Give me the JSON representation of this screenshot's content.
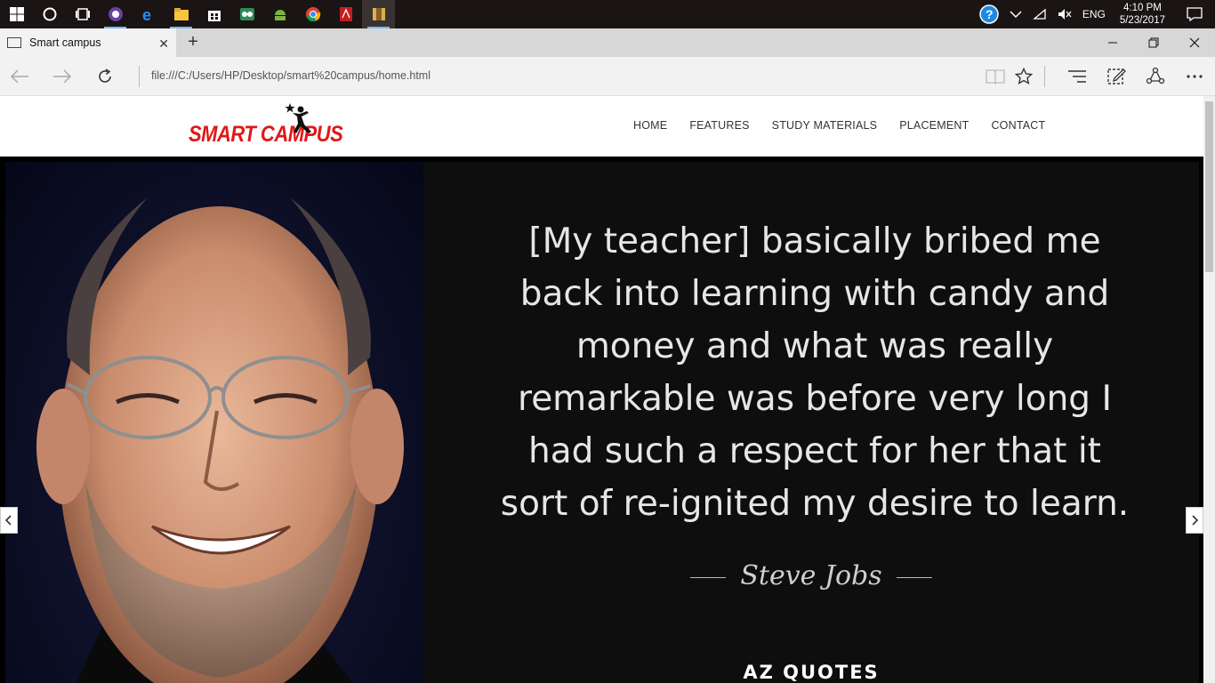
{
  "taskbar": {
    "apps": [
      {
        "icon": "windows-start-icon"
      },
      {
        "icon": "search-cortana-icon"
      },
      {
        "icon": "task-view-icon"
      },
      {
        "icon": "purple-app-icon"
      },
      {
        "icon": "edge-icon"
      },
      {
        "icon": "file-explorer-icon"
      },
      {
        "icon": "store-icon"
      },
      {
        "icon": "tripadvisor-icon"
      },
      {
        "icon": "android-icon"
      },
      {
        "icon": "chrome-icon"
      },
      {
        "icon": "acrobat-icon"
      },
      {
        "icon": "winrar-icon"
      }
    ],
    "tray": {
      "language": "ENG",
      "time": "4:10 PM",
      "date": "5/23/2017"
    }
  },
  "browser": {
    "tab_title": "Smart campus",
    "url": "file:///C:/Users/HP/Desktop/smart%20campus/home.html"
  },
  "site": {
    "logo_text": "SMART CAMPUS",
    "menu": [
      "HOME",
      "FEATURES",
      "STUDY MATERIALS",
      "PLACEMENT",
      "CONTACT"
    ],
    "slide": {
      "quote_lines": [
        "[My teacher] basically bribed me",
        "back into learning with candy and",
        "money and what was really",
        "remarkable was before very long I",
        "had such a respect for her that it",
        "sort of re-ignited my desire to learn."
      ],
      "author": "Steve Jobs",
      "brand": "AZ QUOTES"
    }
  },
  "colors": {
    "logo_red": "#e01818",
    "taskbar_bg": "#1a1414",
    "slide_bg": "#0e0e0e"
  }
}
